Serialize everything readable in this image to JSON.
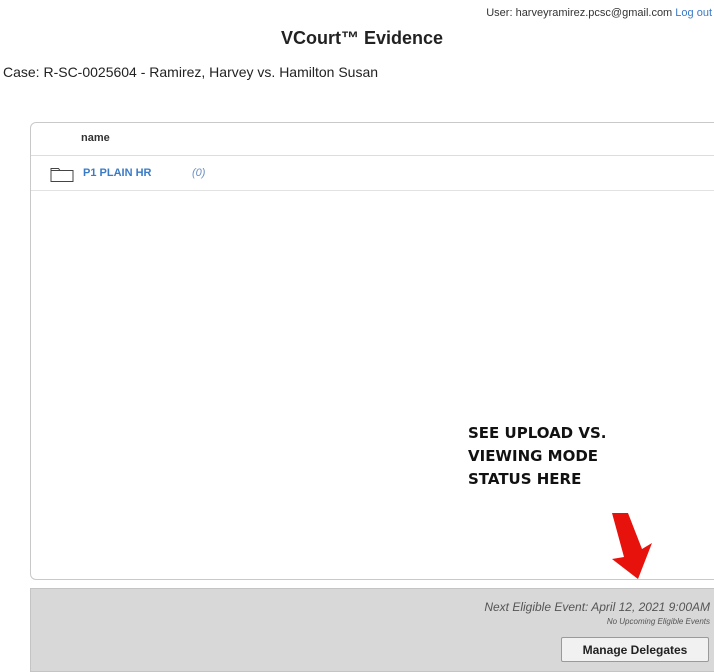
{
  "header": {
    "user_label": "User: harveyramirez.pcsc@gmail.com",
    "logout_label": "Log out",
    "app_title": "VCourt™ Evidence",
    "case_line": "Case: R-SC-0025604 - Ramirez, Harvey vs. Hamilton Susan"
  },
  "file_list": {
    "column_header": "name",
    "items": [
      {
        "icon": "folder-icon",
        "name": "P1 PLAIN HR",
        "count": "(0)"
      }
    ]
  },
  "annotation": {
    "lines": [
      "SEE UPLOAD VS.",
      "VIEWING MODE",
      "STATUS HERE"
    ],
    "arrow_color": "#e8120c"
  },
  "footer": {
    "next_event": "Next Eligible Event: April 12, 2021 9:00AM",
    "no_upcoming": "No Upcoming Eligible Events",
    "manage_delegates_label": "Manage Delegates"
  },
  "colors": {
    "link": "#3a7bc8",
    "footer_bg": "#d8d8d8"
  }
}
